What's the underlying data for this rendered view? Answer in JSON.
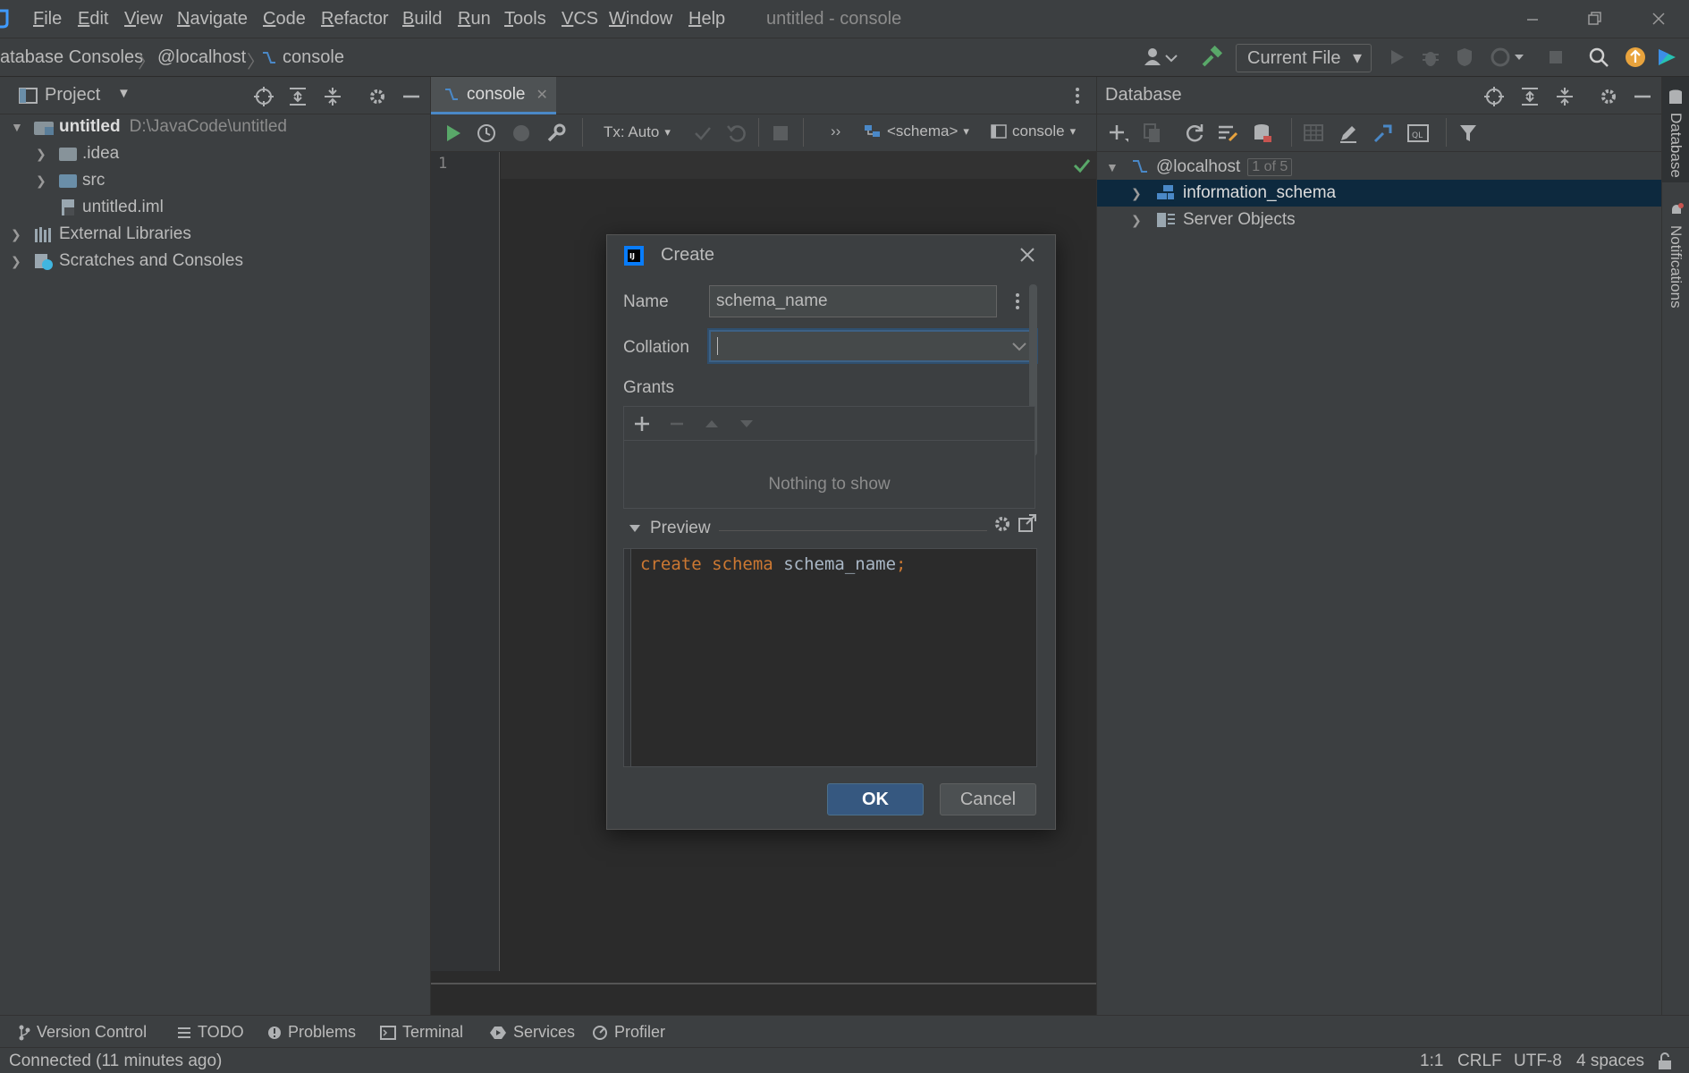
{
  "window": {
    "title": "untitled - console"
  },
  "menu": {
    "items": [
      {
        "label": "File",
        "mn": "F",
        "rest": "ile"
      },
      {
        "label": "Edit",
        "mn": "E",
        "rest": "dit"
      },
      {
        "label": "View",
        "mn": "V",
        "rest": "iew"
      },
      {
        "label": "Navigate",
        "mn": "N",
        "rest": "avigate"
      },
      {
        "label": "Code",
        "mn": "C",
        "rest": "ode"
      },
      {
        "label": "Refactor",
        "mn": "R",
        "rest": "efactor"
      },
      {
        "label": "Build",
        "mn": "B",
        "rest": "uild"
      },
      {
        "label": "Run",
        "mn": "R",
        "rest": "un"
      },
      {
        "label": "Tools",
        "mn": "T",
        "rest": "ools"
      },
      {
        "label": "VCS",
        "mn": "V",
        "rest": "CS"
      },
      {
        "label": "Window",
        "mn": "W",
        "rest": "indow"
      },
      {
        "label": "Help",
        "mn": "H",
        "rest": "elp"
      }
    ]
  },
  "breadcrumb": {
    "items": [
      "atabase Consoles",
      "@localhost",
      "console"
    ]
  },
  "run_config": {
    "label": "Current File"
  },
  "project_panel": {
    "title": "Project",
    "tree": {
      "root_name": "untitled",
      "root_path": "D:\\JavaCode\\untitled",
      "idea": ".idea",
      "src": "src",
      "iml": "untitled.iml",
      "external_libraries": "External Libraries",
      "scratches": "Scratches and Consoles"
    }
  },
  "editor": {
    "tab_label": "console",
    "tx_mode": "Tx: Auto",
    "schema_selector": "<schema>",
    "console_selector": "console",
    "line_numbers": [
      "1"
    ]
  },
  "database_panel": {
    "title": "Database",
    "host": "@localhost",
    "host_count": "1 of 5",
    "items": [
      "information_schema",
      "Server Objects"
    ]
  },
  "side_strip": {
    "database": "Database",
    "notifications": "Notifications"
  },
  "dialog": {
    "title": "Create",
    "name_label": "Name",
    "name_value": "schema_name",
    "collation_label": "Collation",
    "collation_value": "",
    "grants_label": "Grants",
    "grants_empty": "Nothing to show",
    "preview_label": "Preview",
    "sql": {
      "kw1": "create",
      "kw2": "schema",
      "ident": "schema_name",
      "end": ";"
    },
    "ok_label": "OK",
    "cancel_label": "Cancel"
  },
  "tool_windows": [
    "Version Control",
    "TODO",
    "Problems",
    "Terminal",
    "Services",
    "Profiler"
  ],
  "status": {
    "message": "Connected (11 minutes ago)",
    "position": "1:1",
    "line_sep": "CRLF",
    "encoding": "UTF-8",
    "indent": "4 spaces"
  },
  "colors": {
    "accent": "#4a88c7",
    "selection": "#0d293e",
    "keyword": "#cc7832",
    "ok_button": "#365880",
    "run_green": "#59a869"
  }
}
